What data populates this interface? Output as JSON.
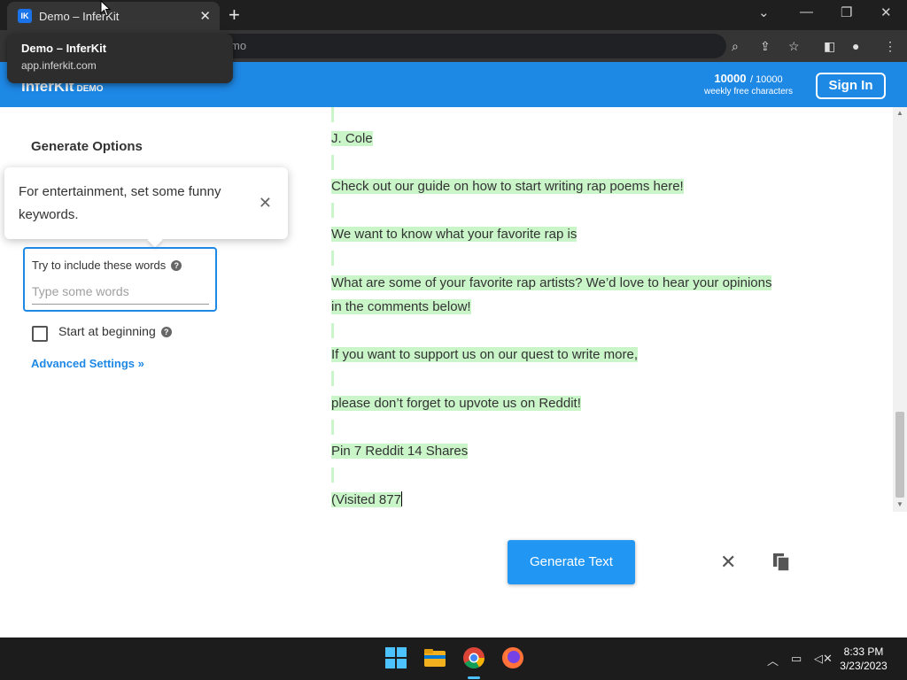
{
  "browser": {
    "tab_title": "Demo – InferKit",
    "tab_favicon": "IK",
    "omnibox_partial": "mo",
    "tooltip_title": "Demo – InferKit",
    "tooltip_url": "app.inferkit.com"
  },
  "header": {
    "brand": "InferKit",
    "brand_sub": "DEMO",
    "quota_num": "10000",
    "quota_den": "/ 10000",
    "quota_sub": "weekly free characters",
    "signin": "Sign In"
  },
  "options": {
    "title": "Generate Options",
    "popover_text": "For entertainment, set some funny keywords.",
    "keywords_label": "Try to include these words",
    "keywords_placeholder": "Type some words",
    "start_label": "Start at beginning",
    "advanced": "Advanced Settings »"
  },
  "content": {
    "lines": [
      "J. Cole",
      "Check out our guide on how to start writing rap poems here!",
      "We want to know what your favorite rap is",
      "What are some of your favorite rap artists? We’d love to hear your opinions",
      "in the comments below!",
      "If you want to support us on our quest to write more,",
      "please don’t forget to upvote us on Reddit!",
      "Pin 7 Reddit 14 Shares",
      "(Visited 877"
    ]
  },
  "actions": {
    "generate": "Generate Text"
  },
  "taskbar": {
    "time": "8:33 PM",
    "date": "3/23/2023"
  },
  "colors": {
    "accent": "#1e88e5",
    "highlight": "#c9f5c9"
  }
}
